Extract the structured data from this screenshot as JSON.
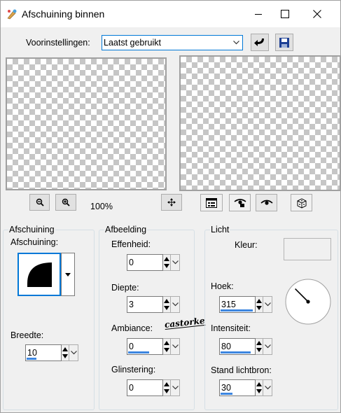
{
  "window": {
    "title": "Afschuining binnen"
  },
  "presets": {
    "label": "Voorinstellingen:",
    "selected": "Laatst gebruikt"
  },
  "zoom": {
    "level": "100%"
  },
  "bevel_group": {
    "title": "Afschuining",
    "shape_label": "Afschuining:",
    "width_label": "Breedte:",
    "width_value": "10",
    "width_fraction": 0.3
  },
  "image_group": {
    "title": "Afbeelding",
    "smoothness_label": "Effenheid:",
    "smoothness_value": "0",
    "smoothness_fraction": 0.0,
    "depth_label": "Diepte:",
    "depth_value": "3",
    "depth_fraction": 0.0,
    "ambience_label": "Ambiance:",
    "ambience_value": "0",
    "ambience_fraction": 0.62,
    "shininess_label": "Glinstering:",
    "shininess_value": "0",
    "shininess_fraction": 0.0
  },
  "light_group": {
    "title": "Licht",
    "color_label": "Kleur:",
    "color_value": "#f0f0f0",
    "angle_label": "Hoek:",
    "angle_value": "315",
    "angle_fraction": 0.95,
    "intensity_label": "Intensiteit:",
    "intensity_value": "80",
    "intensity_fraction": 0.9,
    "elevation_label": "Stand lichtbron:",
    "elevation_value": "30",
    "elevation_fraction": 0.35
  },
  "watermark": {
    "text": "castorke"
  },
  "icons": [
    "app-icon",
    "minimize-icon",
    "maximize-icon",
    "close-icon",
    "chevron-down-icon",
    "reset-arrow-icon",
    "save-disk-icon",
    "zoom-out-icon",
    "zoom-in-icon",
    "move-icon",
    "proof-icon",
    "eye-lock-icon",
    "eye-icon",
    "dice-icon"
  ],
  "colors": {
    "accent": "#3c86e0",
    "focus": "#0078d7",
    "panel": "#f0f0f0"
  }
}
